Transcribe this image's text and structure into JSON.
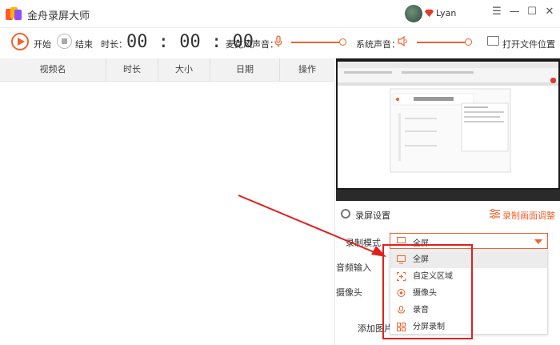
{
  "app": {
    "title": "金舟录屏大师",
    "username": "Lyan"
  },
  "window_controls": {
    "menu": "☰",
    "minimize": "—",
    "maximize": "☐",
    "close": "✕"
  },
  "toolbar": {
    "start_label": "开始",
    "stop_label": "结束",
    "duration_label": "时长：",
    "timer": "00 : 00 : 00",
    "mic_label": "麦克风声音：",
    "system_label": "系统声音：",
    "open_folder_label": "打开文件位置",
    "mic_volume_percent": 100,
    "system_volume_percent": 100
  },
  "table": {
    "columns": [
      "视频名",
      "时长",
      "大小",
      "日期",
      "操作"
    ],
    "rows": []
  },
  "settings": {
    "title": "录屏设置",
    "adjust_label": "录制画面调整",
    "mode_label": "录制模式",
    "mode_value": "全屏",
    "audio_label": "音频输入",
    "camera_label": "摄像头",
    "add_image_label": "添加图片"
  },
  "mode_options": [
    {
      "label": "全屏",
      "icon": "monitor-icon",
      "selected": true
    },
    {
      "label": "自定义区域",
      "icon": "region-icon",
      "selected": false
    },
    {
      "label": "摄像头",
      "icon": "webcam-icon",
      "selected": false
    },
    {
      "label": "录音",
      "icon": "microphone-icon",
      "selected": false
    },
    {
      "label": "分屏录制",
      "icon": "split-screen-icon",
      "selected": false
    }
  ],
  "colors": {
    "accent": "#f0622d",
    "annotation": "#e0201d"
  }
}
